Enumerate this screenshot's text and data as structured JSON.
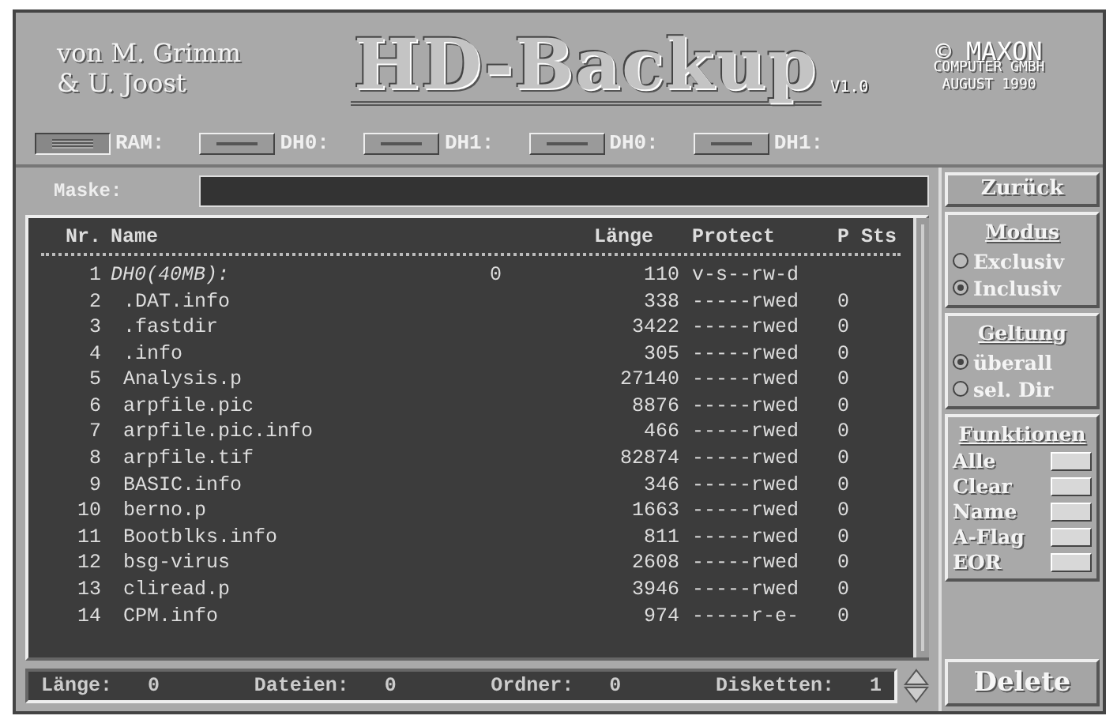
{
  "header": {
    "credits": [
      "von M. Grimm",
      "& U. Joost"
    ],
    "title": "HD-Backup",
    "version": "V1.0",
    "publisher": [
      "© MAXON",
      "COMPUTER GMBH",
      "AUGUST 1990"
    ]
  },
  "drives": [
    {
      "label": "RAM:",
      "selected": true
    },
    {
      "label": "DH0:",
      "selected": false
    },
    {
      "label": "DH1:",
      "selected": false
    },
    {
      "label": "DH0:",
      "selected": false
    },
    {
      "label": "DH1:",
      "selected": false
    }
  ],
  "mask": {
    "label": "Maske:"
  },
  "list": {
    "columns": [
      "Nr.",
      "Name",
      "Länge",
      "Protect",
      "P Sts"
    ],
    "rows": [
      {
        "nr": "1",
        "name": "DH0(40MB):",
        "kind": "volume",
        "marker": "0",
        "length": "110",
        "protect": "v-s--rw-d"
      },
      {
        "nr": "2",
        "name": ".DAT.info",
        "kind": "file",
        "length": "338",
        "protect": "-----rwed",
        "status": "0"
      },
      {
        "nr": "3",
        "name": ".fastdir",
        "kind": "file",
        "length": "3422",
        "protect": "-----rwed",
        "status": "0"
      },
      {
        "nr": "4",
        "name": ".info",
        "kind": "file",
        "length": "305",
        "protect": "-----rwed",
        "status": "0"
      },
      {
        "nr": "5",
        "name": "Analysis.p",
        "kind": "file",
        "length": "27140",
        "protect": "-----rwed",
        "status": "0"
      },
      {
        "nr": "6",
        "name": "arpfile.pic",
        "kind": "file",
        "length": "8876",
        "protect": "-----rwed",
        "status": "0"
      },
      {
        "nr": "7",
        "name": "arpfile.pic.info",
        "kind": "file",
        "length": "466",
        "protect": "-----rwed",
        "status": "0"
      },
      {
        "nr": "8",
        "name": "arpfile.tif",
        "kind": "file",
        "length": "82874",
        "protect": "-----rwed",
        "status": "0"
      },
      {
        "nr": "9",
        "name": "BASIC.info",
        "kind": "file",
        "length": "346",
        "protect": "-----rwed",
        "status": "0"
      },
      {
        "nr": "10",
        "name": "berno.p",
        "kind": "file",
        "length": "1663",
        "protect": "-----rwed",
        "status": "0"
      },
      {
        "nr": "11",
        "name": "Bootblks.info",
        "kind": "file",
        "length": "811",
        "protect": "-----rwed",
        "status": "0"
      },
      {
        "nr": "12",
        "name": "bsg-virus",
        "kind": "file",
        "length": "2608",
        "protect": "-----rwed",
        "status": "0"
      },
      {
        "nr": "13",
        "name": "cliread.p",
        "kind": "file",
        "length": "3946",
        "protect": "-----rwed",
        "status": "0"
      },
      {
        "nr": "14",
        "name": "CPM.info",
        "kind": "file",
        "length": "974",
        "protect": "-----r-e-",
        "status": "0"
      }
    ]
  },
  "footer": [
    {
      "label": "Länge:",
      "value": "0"
    },
    {
      "label": "Dateien:",
      "value": "0"
    },
    {
      "label": "Ordner:",
      "value": "0"
    },
    {
      "label": "Disketten:",
      "value": "1"
    }
  ],
  "sidebar": {
    "back": "Zurück",
    "groups": [
      {
        "title": "Modus",
        "options": [
          {
            "label": "Exclusiv",
            "selected": false
          },
          {
            "label": "Inclusiv",
            "selected": true
          }
        ]
      },
      {
        "title": "Geltung",
        "options": [
          {
            "label": "überall",
            "selected": true
          },
          {
            "label": "sel. Dir",
            "selected": false
          }
        ]
      }
    ],
    "functions": {
      "title": "Funktionen",
      "items": [
        "Alle",
        "Clear",
        "Name",
        "A-Flag",
        "EOR"
      ]
    },
    "delete": "Delete"
  }
}
